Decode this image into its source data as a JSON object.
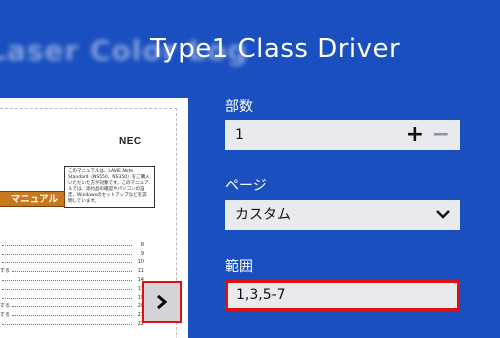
{
  "header": {
    "printer_name_blurred": "Laser Color Log",
    "driver_title": "Type1 Class Driver"
  },
  "preview": {
    "brand": "NEC",
    "notice_text": "このマニュアルは、LAVIE Note Standard（NS550、NS350）をご購入いただいた方が対象です。このマニュアルでは、添付品の確認やパソコンの設定、Windowsのセットアップなどを説明しています。",
    "manual_banner": "マニュアル",
    "toc": [
      {
        "label": "",
        "page": "8"
      },
      {
        "label": "",
        "page": "9"
      },
      {
        "label": "",
        "page": "10"
      },
      {
        "label": "する",
        "page": "11"
      },
      {
        "label": "",
        "page": "14"
      },
      {
        "label": "",
        "page": "17"
      },
      {
        "label": "",
        "page": "19"
      },
      {
        "label": "する",
        "page": "20"
      },
      {
        "label": "する",
        "page": "21"
      },
      {
        "label": "",
        "page": "22"
      }
    ]
  },
  "form": {
    "copies_label": "部数",
    "copies_value": "1",
    "plus_symbol": "+",
    "minus_symbol": "−",
    "page_label": "ページ",
    "page_value": "カスタム",
    "range_label": "範囲",
    "range_value": "1,3,5-7"
  },
  "colors": {
    "background": "#1a4fc0",
    "highlight": "#e01010",
    "field_background": "#e8eaee",
    "manual_banner": "#c8781d"
  },
  "icons": {
    "next_page": "chevron-right-icon",
    "dropdown": "chevron-down-icon"
  }
}
